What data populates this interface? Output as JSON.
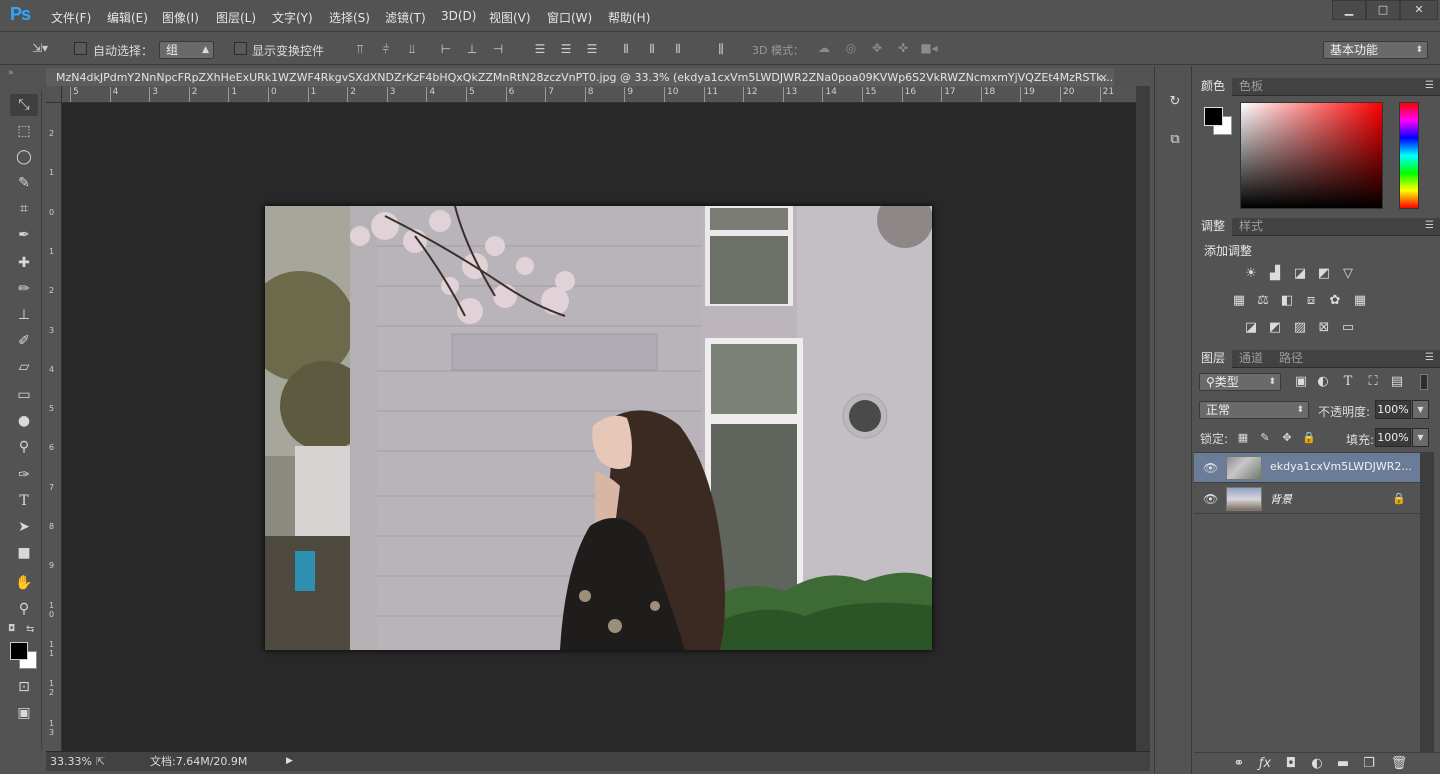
{
  "app": {
    "logo": "Ps"
  },
  "menu": [
    "文件(F)",
    "编辑(E)",
    "图像(I)",
    "图层(L)",
    "文字(Y)",
    "选择(S)",
    "滤镜(T)",
    "3D(D)",
    "视图(V)",
    "窗口(W)",
    "帮助(H)"
  ],
  "window_controls": {
    "minimize": "▁",
    "restore": "□",
    "close": "✕"
  },
  "options": {
    "auto_select_label": "自动选择：",
    "auto_select_value": "组",
    "show_transform_label": "显示变换控件",
    "mode3d_label": "3D 模式：",
    "workspace_value": "基本功能"
  },
  "document": {
    "tab_title": "MzN4dkJPdmY2NnNpcFRpZXhHeExURk1WZWF4RkgvSXdXNDZrKzF4bHQxQkZZMnRtN28zczVnPT0.jpg @ 33.3% (ekdya1cxVm5LWDJWR2ZNa0poa09KVWp6S2VkRWZNcmxmYjVQZEt4MzRSTk...",
    "close": "×",
    "hruler_ticks": [
      "5",
      "4",
      "3",
      "2",
      "1",
      "0",
      "1",
      "2",
      "3",
      "4",
      "5",
      "6",
      "7",
      "8",
      "9",
      "10",
      "11",
      "12",
      "13",
      "14",
      "15",
      "16",
      "17",
      "18",
      "19",
      "20",
      "21"
    ],
    "vruler_ticks": [
      "2",
      "1",
      "0",
      "1",
      "2",
      "3",
      "4",
      "5",
      "6",
      "7",
      "8",
      "9",
      "1\n0",
      "1\n1",
      "1\n2",
      "1\n3"
    ]
  },
  "status": {
    "zoom": "33.33%",
    "doc_info": "文档:7.64M/20.9M"
  },
  "color_panel": {
    "tabs": [
      "颜色",
      "色板"
    ],
    "foreground": "#000000",
    "background": "#ffffff"
  },
  "adjust_panel": {
    "tabs": [
      "调整",
      "样式"
    ],
    "title": "添加调整"
  },
  "layers_panel": {
    "tabs": [
      "图层",
      "通道",
      "路径"
    ],
    "filter_value": "类型",
    "blend_value": "正常",
    "opacity_label": "不透明度:",
    "opacity_value": "100%",
    "lock_label": "锁定:",
    "fill_label": "填充:",
    "fill_value": "100%",
    "layers": [
      {
        "name": "ekdya1cxVm5LWDJWR2..."
      },
      {
        "name": "背景"
      }
    ]
  },
  "colors": {
    "accent": "#31a8ff",
    "selected_layer": "#6a7c98",
    "canvas_bg": "#282828"
  }
}
